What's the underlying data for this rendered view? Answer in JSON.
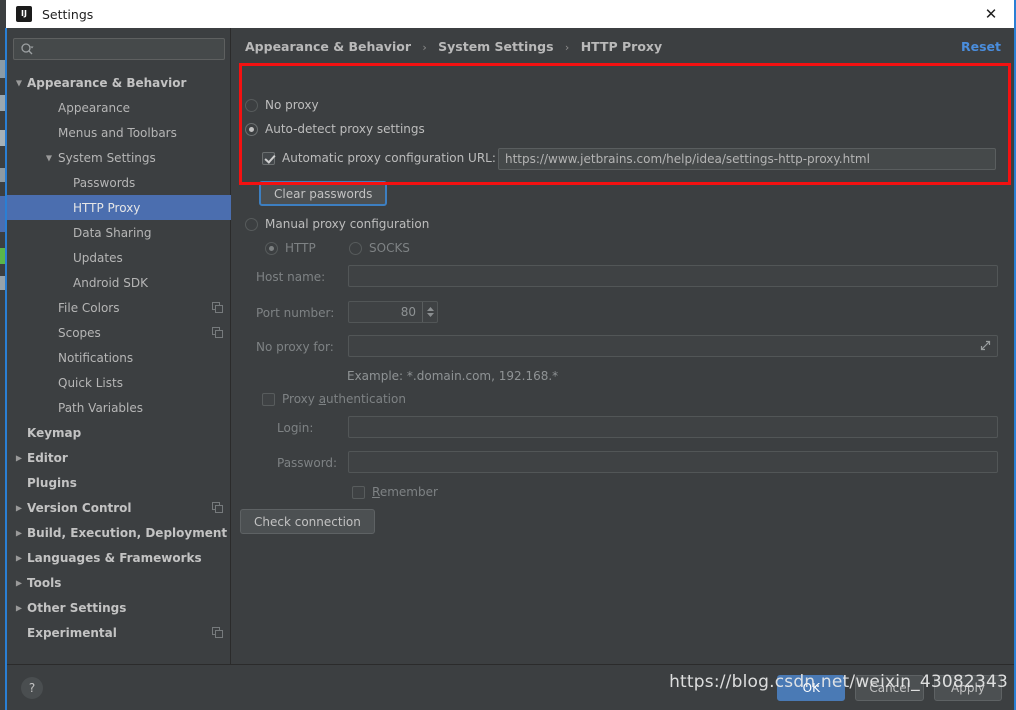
{
  "window": {
    "title": "Settings",
    "app_icon": "intellij-idea-icon",
    "close_icon": "close-icon"
  },
  "sidebar": {
    "search": {
      "placeholder": "",
      "value": "",
      "icon": "search-icon"
    },
    "items": [
      {
        "label": "Appearance & Behavior",
        "level": 0,
        "twisty": "▼",
        "selected": false,
        "copy": false
      },
      {
        "label": "Appearance",
        "level": 1,
        "twisty": "",
        "selected": false,
        "copy": false
      },
      {
        "label": "Menus and Toolbars",
        "level": 1,
        "twisty": "",
        "selected": false,
        "copy": false
      },
      {
        "label": "System Settings",
        "level": 1,
        "twisty": "▼",
        "selected": false,
        "copy": false
      },
      {
        "label": "Passwords",
        "level": 2,
        "twisty": "",
        "selected": false,
        "copy": false
      },
      {
        "label": "HTTP Proxy",
        "level": 2,
        "twisty": "",
        "selected": true,
        "copy": false
      },
      {
        "label": "Data Sharing",
        "level": 2,
        "twisty": "",
        "selected": false,
        "copy": false
      },
      {
        "label": "Updates",
        "level": 2,
        "twisty": "",
        "selected": false,
        "copy": false
      },
      {
        "label": "Android SDK",
        "level": 2,
        "twisty": "",
        "selected": false,
        "copy": false
      },
      {
        "label": "File Colors",
        "level": 1,
        "twisty": "",
        "selected": false,
        "copy": true
      },
      {
        "label": "Scopes",
        "level": 1,
        "twisty": "",
        "selected": false,
        "copy": true
      },
      {
        "label": "Notifications",
        "level": 1,
        "twisty": "",
        "selected": false,
        "copy": false
      },
      {
        "label": "Quick Lists",
        "level": 1,
        "twisty": "",
        "selected": false,
        "copy": false
      },
      {
        "label": "Path Variables",
        "level": 1,
        "twisty": "",
        "selected": false,
        "copy": false
      },
      {
        "label": "Keymap",
        "level": 0,
        "twisty": "",
        "selected": false,
        "copy": false
      },
      {
        "label": "Editor",
        "level": 0,
        "twisty": "▶",
        "selected": false,
        "copy": false
      },
      {
        "label": "Plugins",
        "level": 0,
        "twisty": "",
        "selected": false,
        "copy": false
      },
      {
        "label": "Version Control",
        "level": 0,
        "twisty": "▶",
        "selected": false,
        "copy": true
      },
      {
        "label": "Build, Execution, Deployment",
        "level": 0,
        "twisty": "▶",
        "selected": false,
        "copy": false
      },
      {
        "label": "Languages & Frameworks",
        "level": 0,
        "twisty": "▶",
        "selected": false,
        "copy": false
      },
      {
        "label": "Tools",
        "level": 0,
        "twisty": "▶",
        "selected": false,
        "copy": false
      },
      {
        "label": "Other Settings",
        "level": 0,
        "twisty": "▶",
        "selected": false,
        "copy": false
      },
      {
        "label": "Experimental",
        "level": 0,
        "twisty": "",
        "selected": false,
        "copy": true
      }
    ]
  },
  "content": {
    "breadcrumb": {
      "part1": "Appearance & Behavior",
      "part2": "System Settings",
      "part3": "HTTP Proxy",
      "separator": "›"
    },
    "reset_label": "Reset",
    "no_proxy_label": "No proxy",
    "auto_detect_label": "Auto-detect proxy settings",
    "auto_config_url_label": "Automatic proxy configuration URL:",
    "auto_config_url_value": "https://www.jetbrains.com/help/idea/settings-http-proxy.html",
    "clear_passwords_label": "Clear passwords",
    "manual_proxy_label": "Manual proxy configuration",
    "http_label": "HTTP",
    "socks_label": "SOCKS",
    "host_name_label": "Host name:",
    "host_name_value": "",
    "port_number_label": "Port number:",
    "port_number_value": "80",
    "no_proxy_for_label": "No proxy for:",
    "no_proxy_for_value": "",
    "example_text": "Example: *.domain.com, 192.168.*",
    "proxy_auth_label_pre": "Proxy ",
    "proxy_auth_label_mnemonic": "a",
    "proxy_auth_label_post": "uthentication",
    "login_label": "Login:",
    "login_value": "",
    "password_label": "Password:",
    "password_value": "",
    "remember_label_mnemonic": "R",
    "remember_label_post": "emember",
    "check_connection_label": "Check connection"
  },
  "bottom": {
    "help_label": "?",
    "ok_label": "OK",
    "cancel_label": "Cancel",
    "apply_label": "Apply"
  },
  "watermark": {
    "text": "https://blog.csdn.net/weixin_43082343"
  },
  "colors": {
    "accent_blue": "#4b6eaf",
    "link_blue": "#4a8ddc",
    "annotation_red": "#f41111",
    "panel_bg": "#3c3f41",
    "default_button": "#4a7ab5"
  }
}
